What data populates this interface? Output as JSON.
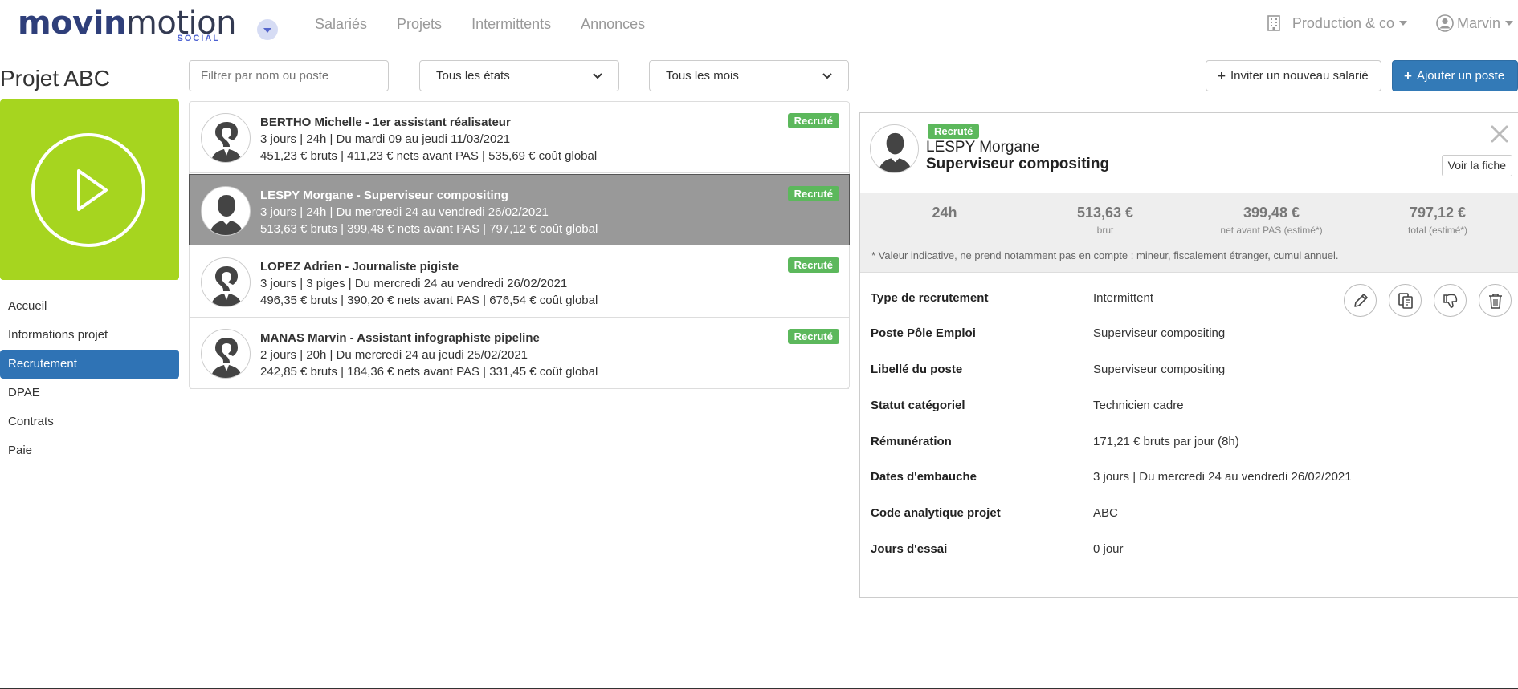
{
  "header": {
    "logo_main_a": "movin",
    "logo_main_b": "motion",
    "logo_sub": "SOCIAL",
    "nav": [
      "Salariés",
      "Projets",
      "Intermittents",
      "Annonces"
    ],
    "company": "Production & co",
    "user": "Marvin"
  },
  "sidebar": {
    "project_title": "Projet ABC",
    "items": [
      {
        "label": "Accueil"
      },
      {
        "label": "Informations projet"
      },
      {
        "label": "Recrutement"
      },
      {
        "label": "DPAE"
      },
      {
        "label": "Contrats"
      },
      {
        "label": "Paie"
      }
    ]
  },
  "filters": {
    "search_placeholder": "Filtrer par nom ou poste",
    "state_select": "Tous les états",
    "month_select": "Tous les mois",
    "invite_label": "Inviter un nouveau salarié",
    "add_label": "Ajouter un poste"
  },
  "list": [
    {
      "title": "BERTHO Michelle - 1er assistant réalisateur",
      "line2": "3 jours | 24h | Du mardi 09 au jeudi 11/03/2021",
      "line3": "451,23 € bruts | 411,23 € nets avant PAS | 535,69 € coût global",
      "badge": "Recruté",
      "avatar": "question-avatar-icon"
    },
    {
      "title": "LESPY Morgane - Superviseur compositing",
      "line2": "3 jours | 24h | Du mercredi 24 au vendredi 26/02/2021",
      "line3": "513,63 € bruts | 399,48 € nets avant PAS | 797,12 € coût global",
      "badge": "Recruté",
      "avatar": "person-avatar-icon"
    },
    {
      "title": "LOPEZ Adrien - Journaliste pigiste",
      "line2": "3 jours | 3 piges | Du mercredi 24 au vendredi 26/02/2021",
      "line3": "496,35 € bruts | 390,20 € nets avant PAS | 676,54 € coût global",
      "badge": "Recruté",
      "avatar": "question-avatar-icon"
    },
    {
      "title": "MANAS Marvin - Assistant infographiste pipeline",
      "line2": "2 jours | 20h | Du mercredi 24 au jeudi 25/02/2021",
      "line3": "242,85 € bruts | 184,36 € nets avant PAS | 331,45 € coût global",
      "badge": "Recruté",
      "avatar": "question-avatar-icon"
    }
  ],
  "detail": {
    "badge": "Recruté",
    "name": "LESPY Morgane",
    "role": "Superviseur compositing",
    "view_label": "Voir la fiche",
    "stats": [
      {
        "value": "24h",
        "label": ""
      },
      {
        "value": "513,63 €",
        "label": "brut"
      },
      {
        "value": "399,48 €",
        "label": "net avant PAS (estimé*)"
      },
      {
        "value": "797,12 €",
        "label": "total (estimé*)"
      }
    ],
    "note": "* Valeur indicative, ne prend notamment pas en compte : mineur, fiscalement étranger, cumul annuel.",
    "fields": [
      {
        "key": "Type de recrutement",
        "value": "Intermittent"
      },
      {
        "key": "Poste Pôle Emploi",
        "value": "Superviseur compositing"
      },
      {
        "key": "Libellé du poste",
        "value": "Superviseur compositing"
      },
      {
        "key": "Statut catégoriel",
        "value": "Technicien cadre"
      },
      {
        "key": "Rémunération",
        "value": "171,21 € bruts par jour (8h)"
      },
      {
        "key": "Dates d'embauche",
        "value": "3 jours | Du mercredi 24 au vendredi 26/02/2021"
      },
      {
        "key": "Code analytique projet",
        "value": "ABC"
      },
      {
        "key": "Jours d'essai",
        "value": "0 jour"
      }
    ],
    "actions": [
      "edit-icon",
      "duplicate-icon",
      "reject-icon",
      "delete-icon"
    ]
  }
}
